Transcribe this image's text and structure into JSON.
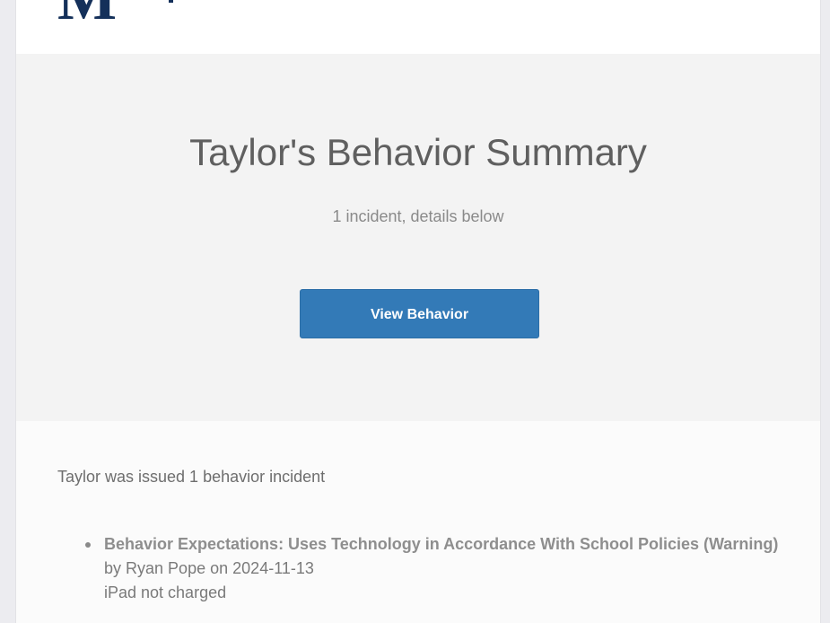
{
  "header": {
    "logo_text": "M"
  },
  "hero": {
    "title": "Taylor's Behavior Summary",
    "subtitle": "1 incident, details below",
    "button_label": "View Behavior"
  },
  "content": {
    "intro": "Taylor was issued 1 behavior incident",
    "incidents": [
      {
        "title": "Behavior Expectations: Uses Technology in Accordance With School Policies (Warning)",
        "by_label": "by",
        "staff": "Ryan Pope",
        "on_label": "on",
        "date": "2024-11-13",
        "note": "iPad not charged"
      }
    ]
  },
  "colors": {
    "button": "#337ab7",
    "hero_background": "#f3f3f3",
    "logo": "#14305a"
  }
}
